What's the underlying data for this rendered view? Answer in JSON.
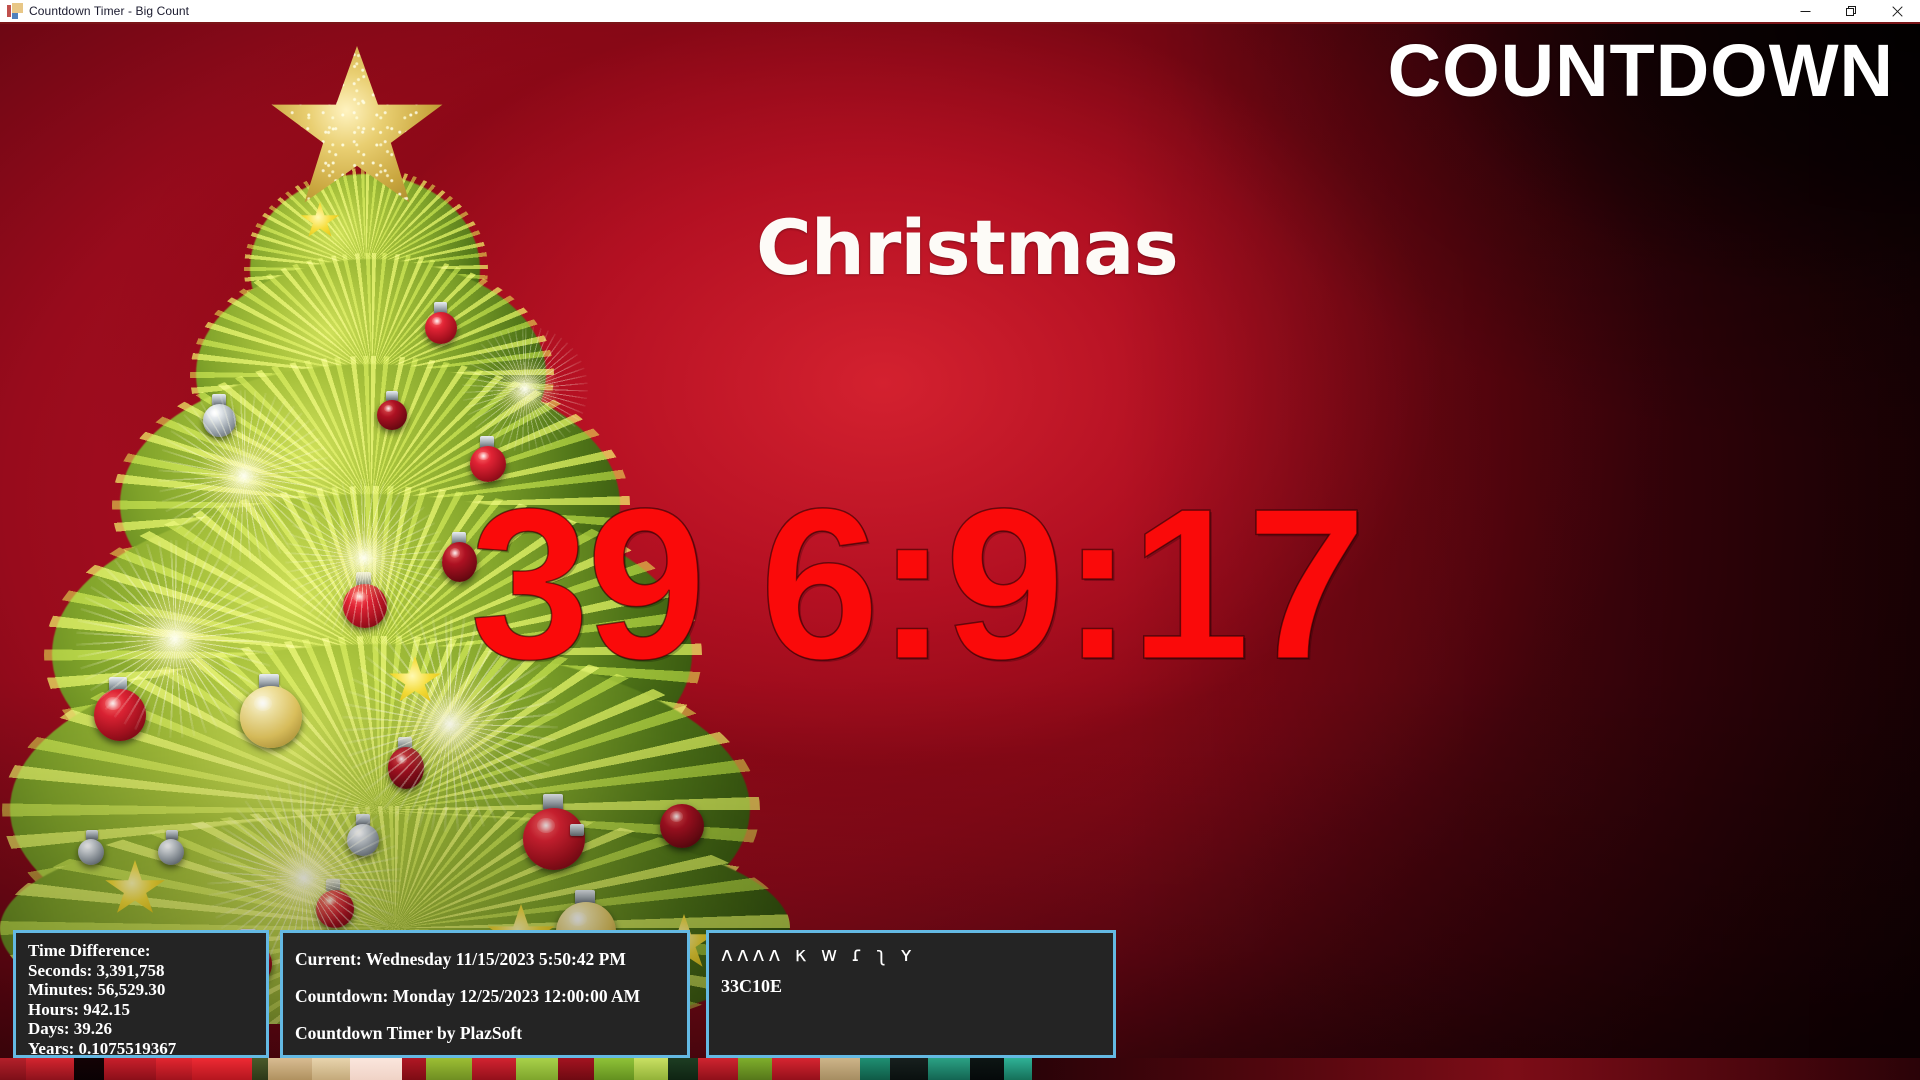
{
  "window": {
    "title": "Countdown Timer - Big Count",
    "icon": "vb-app-icon",
    "controls": [
      {
        "name": "minimize-button",
        "label": "─",
        "icon": "minimize-icon"
      },
      {
        "name": "restore-button",
        "label": "❐",
        "icon": "restore-icon"
      },
      {
        "name": "close-button",
        "label": "✕",
        "icon": "close-icon"
      }
    ]
  },
  "header": {
    "countdown_label": "COUNTDOWN"
  },
  "main": {
    "event_title": "Christmas",
    "big_count": "39 6:9:17"
  },
  "panels": {
    "time_difference": {
      "title": "Time Difference:",
      "seconds_label": "Seconds: 3,391,758",
      "minutes_label": "Minutes: 56,529.30",
      "hours_label": "Hours: 942.15",
      "days_label": "Days: 39.26",
      "years_label": "Years: 0.1075519367"
    },
    "dates": {
      "current": "Current: Wednesday 11/15/2023 5:50:42 PM",
      "countdown": "Countdown: Monday 12/25/2023 12:00:00 AM",
      "credit": "Countdown Timer by PlazSoft"
    },
    "symbols": {
      "glyph_row": "ʌʌʌʌ κ ᴡ ɾ ʅ ʏ",
      "code": "33C10E"
    }
  },
  "colors": {
    "panel_border": "#64b9e3",
    "panel_background": "#242424",
    "count_red": "#fa0a0a",
    "backdrop_red": "#b81223",
    "title_white": "#fdfbf7",
    "titlebar_accent": "#7a1518"
  },
  "decor": {
    "tree_alt": "christmas-tree-photo",
    "star_alt": "gold-star-tree-topper"
  }
}
